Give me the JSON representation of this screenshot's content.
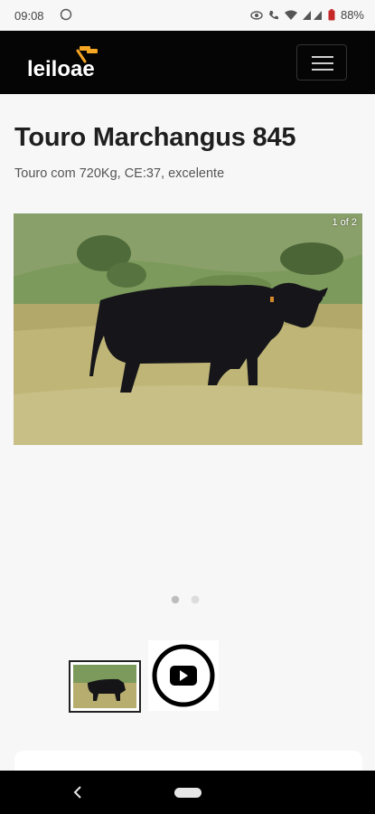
{
  "status_bar": {
    "time": "09:08",
    "icons": [
      "whatsapp-icon",
      "eye-icon",
      "call-icon",
      "wifi-icon",
      "signal-icon",
      "battery-icon"
    ],
    "battery": "88%"
  },
  "header": {
    "logo_text": "leiloae",
    "menu_icon": "hamburger-icon",
    "colors": {
      "background": "#050505",
      "accent": "#f5a623"
    }
  },
  "product": {
    "title": "Touro Marchangus 845",
    "description": "Touro com 720Kg, CE:37, excelente"
  },
  "gallery": {
    "counter": "1 of 2",
    "total": 2,
    "active_index": 0,
    "thumbnails": [
      "photo-thumbnail",
      "youtube-thumbnail"
    ]
  },
  "navigation_bar": {
    "icons": [
      "back-icon",
      "home-pill"
    ]
  }
}
